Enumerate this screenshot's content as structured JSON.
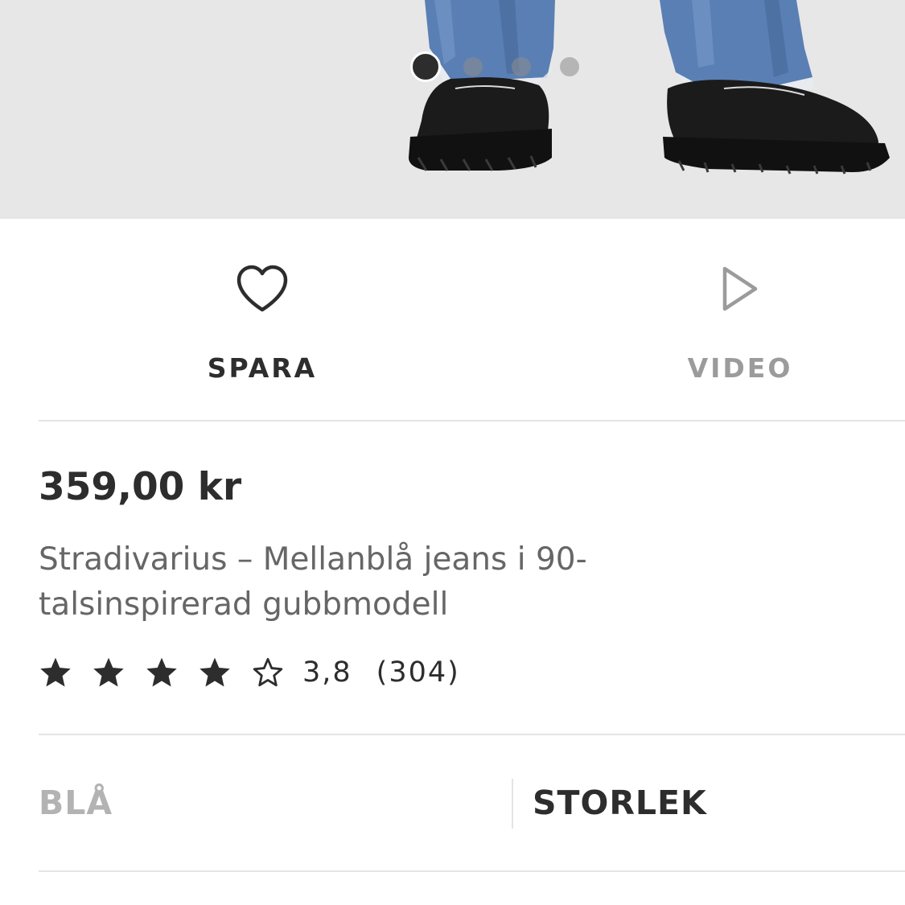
{
  "gallery": {
    "image_alt": "Product photo: jeans with raw hem and black chunky lace-up shoes",
    "dot_count": 4,
    "active_index": 0
  },
  "actions": {
    "save": {
      "label": "SPARA",
      "icon": "heart-icon"
    },
    "video": {
      "label": "VIDEO",
      "icon": "play-icon"
    }
  },
  "product": {
    "price": "359,00 kr",
    "title": "Stradivarius – Mellanblå jeans i 90-talsinspirerad gubbmodell"
  },
  "rating": {
    "score": "3,8",
    "count": "(304)",
    "stars_filled": 4,
    "stars_total": 5
  },
  "selectors": {
    "color": "BLÅ",
    "size": "STORLEK"
  },
  "colors": {
    "text_dark": "#2d2d2d",
    "text_muted": "#9b9b9b",
    "text_disabled": "#b3b3b3",
    "image_bg": "#e7e7e7",
    "divider": "#e4e4e4"
  }
}
